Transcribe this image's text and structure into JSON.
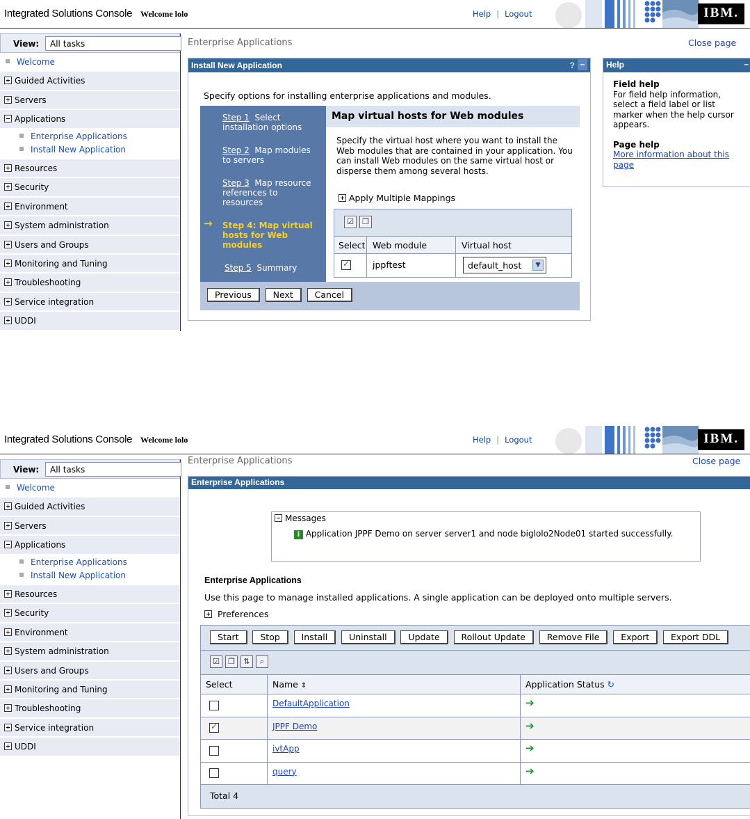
{
  "header": {
    "product": "Integrated Solutions Console",
    "welcome": "Welcome lolo",
    "help": "Help",
    "separator": "|",
    "logout": "Logout",
    "logo": "IBM."
  },
  "nav": {
    "view_label": "View:",
    "view_value": "All tasks",
    "welcome": "Welcome",
    "guided": "Guided Activities",
    "servers": "Servers",
    "applications": "Applications",
    "enterprise_apps": "Enterprise Applications",
    "install_new": "Install New Application",
    "resources": "Resources",
    "security": "Security",
    "environment": "Environment",
    "sysadmin": "System administration",
    "users": "Users and Groups",
    "monitoring": "Monitoring and Tuning",
    "troubleshooting": "Troubleshooting",
    "service_integration": "Service integration",
    "uddi": "UDDI"
  },
  "screen1": {
    "breadcrumb": "Enterprise Applications",
    "close_page": "Close page",
    "panel_title": "Install New Application",
    "panel_help_q": "?",
    "panel_min": "–",
    "intro": "Specify options for installing enterprise applications and modules.",
    "steps": {
      "s1_link": "Step 1",
      "s1_text": "Select installation options",
      "s2_link": "Step 2",
      "s2_text": "Map modules to servers",
      "s3_link": "Step 3",
      "s3_text": "Map resource references to resources",
      "s4_text": "Step 4: Map virtual hosts for Web modules",
      "s5_link": "Step 5",
      "s5_text": "Summary"
    },
    "step_title": "Map virtual hosts for Web modules",
    "step_desc": "Specify the virtual host where you want to install the Web modules that are contained in your application. You can install Web modules on the same virtual host or disperse them among several hosts.",
    "apply_multiple": "Apply Multiple Mappings",
    "table": {
      "headers": [
        "Select",
        "Web module",
        "Virtual host"
      ],
      "row_module": "jppftest",
      "row_host": "default_host"
    },
    "buttons": {
      "previous": "Previous",
      "next": "Next",
      "cancel": "Cancel"
    },
    "help_panel": {
      "title": "Help",
      "field_help_title": "Field help",
      "field_help_text": "For field help information, select a field label or list marker when the help cursor appears.",
      "page_help_title": "Page help",
      "page_help_link": "More information about this page"
    }
  },
  "screen2": {
    "breadcrumb": "Enterprise Applications",
    "close_page": "Close page",
    "panel_title": "Enterprise Applications",
    "messages_label": "Messages",
    "message_text": "Application JPPF Demo on server server1 and node biglolo2Node01 started successfully.",
    "section_title": "Enterprise Applications",
    "section_desc": "Use this page to manage installed applications. A single application can be deployed onto multiple servers.",
    "preferences": "Preferences",
    "buttons": [
      "Start",
      "Stop",
      "Install",
      "Uninstall",
      "Update",
      "Rollout Update",
      "Remove File",
      "Export",
      "Export DDL"
    ],
    "headers": {
      "select": "Select",
      "name": "Name",
      "status": "Application Status"
    },
    "rows": [
      {
        "name": "DefaultApplication",
        "checked": false
      },
      {
        "name": "JPPF Demo",
        "checked": true
      },
      {
        "name": "ivtApp",
        "checked": false
      },
      {
        "name": "query",
        "checked": false
      }
    ],
    "total": "Total 4"
  }
}
